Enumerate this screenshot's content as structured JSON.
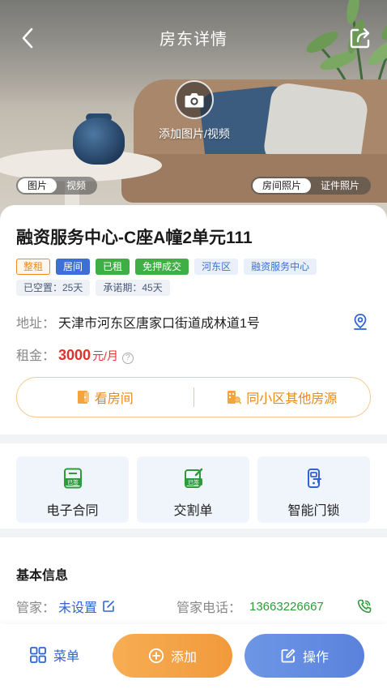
{
  "header": {
    "title": "房东详情",
    "back_icon": "chevron-left-icon",
    "share_icon": "share-icon"
  },
  "hero": {
    "add_media_label": "添加图片/视频",
    "media_tabs": [
      "图片",
      "视频"
    ],
    "media_tab_active": "图片",
    "photo_tabs": [
      "房间照片",
      "证件照片"
    ],
    "photo_tab_active": "房间照片"
  },
  "room": {
    "title": "融资服务中心-C座A幢2单元111",
    "tags": [
      "整租",
      "居间",
      "已租",
      "免押成交",
      "河东区",
      "融资服务中心"
    ],
    "vacancy": "已空置：25天",
    "commitment": "承诺期：45天",
    "address_label": "地址：",
    "address": "天津市河东区唐家口街道成林道1号",
    "rent_label": "租金：",
    "rent_value": "3000",
    "rent_unit": "元/月",
    "view_room": "看房间",
    "same_community": "同小区其他房源"
  },
  "documents": [
    {
      "label": "电子合同",
      "badge": "已签",
      "icon": "contract-signed-icon"
    },
    {
      "label": "交割单",
      "badge": "已签",
      "icon": "handover-signed-icon"
    },
    {
      "label": "智能门锁",
      "icon": "smart-lock-icon"
    }
  ],
  "basic_info": {
    "title": "基本信息",
    "manager_label": "管家：",
    "manager_value": "未设置",
    "phone_label": "管家电话：",
    "phone_value": "13663226667"
  },
  "bottom_bar": {
    "menu": "菜单",
    "add": "添加",
    "operate": "操作"
  },
  "colors": {
    "brand_blue": "#3d6fd6",
    "accent_orange": "#f19a3c",
    "rent_red": "#e0312b",
    "phone_green": "#2e9a3a"
  }
}
